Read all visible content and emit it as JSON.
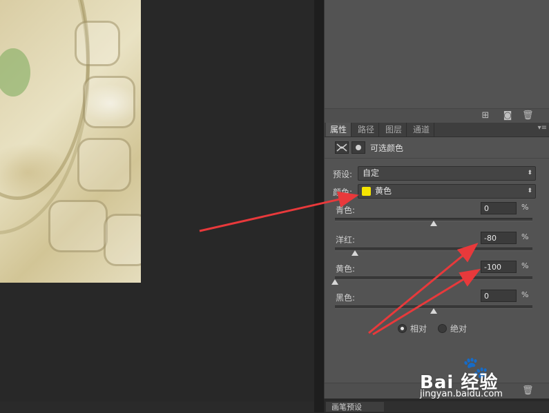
{
  "properties_panel": {
    "tabs": [
      "属性",
      "路径",
      "图层",
      "通道"
    ],
    "title": "可选颜色",
    "preset_label": "预设:",
    "preset_value": "自定",
    "colors_label": "颜色:",
    "colors_value": "黄色",
    "colors_swatch": "#f5e400",
    "sliders": [
      {
        "label": "青色:",
        "value": "0",
        "unit": "%",
        "level": 0
      },
      {
        "label": "洋红:",
        "value": "-80",
        "unit": "%",
        "level": -80
      },
      {
        "label": "黄色:",
        "value": "-100",
        "unit": "%",
        "level": -100
      },
      {
        "label": "黑色:",
        "value": "0",
        "unit": "%",
        "level": 0
      }
    ],
    "method": {
      "relative": "相对",
      "absolute": "绝对",
      "selected": "relative"
    }
  },
  "bottom_tab": "画笔预设",
  "watermark": {
    "brand": "Bai 经验",
    "url": "jingyan.baidu.com"
  },
  "icons": [
    "new-layer-icon",
    "camera-icon",
    "trash-icon",
    "mask-icon",
    "adjustment-icon",
    "panel-menu-icon"
  ],
  "colors": {
    "panel_bg": "#535353",
    "workspace_bg": "#282828",
    "annotation_arrow": "#e8393b"
  }
}
